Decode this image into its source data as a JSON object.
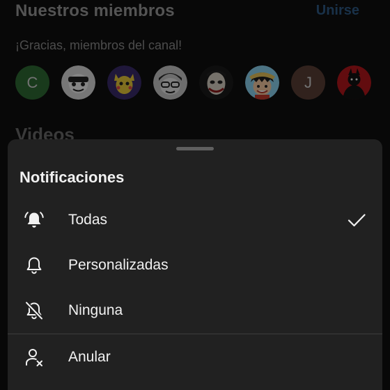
{
  "background": {
    "members_title": "Nuestros miembros",
    "join_label": "Unirse",
    "thanks_text": "¡Gracias, miembros del canal!",
    "members": [
      {
        "initial": "C",
        "type": "letter"
      },
      {
        "initial": "",
        "type": "avatar-1"
      },
      {
        "initial": "",
        "type": "avatar-2"
      },
      {
        "initial": "",
        "type": "avatar-3"
      },
      {
        "initial": "",
        "type": "avatar-4"
      },
      {
        "initial": "",
        "type": "avatar-5"
      },
      {
        "initial": "J",
        "type": "letter"
      },
      {
        "initial": "",
        "type": "avatar-6"
      }
    ],
    "videos_title": "Videos"
  },
  "sheet": {
    "title": "Notificaciones",
    "options": [
      {
        "label": "Todas",
        "icon": "bell-ringing-icon",
        "selected": true
      },
      {
        "label": "Personalizadas",
        "icon": "bell-icon",
        "selected": false
      },
      {
        "label": "Ninguna",
        "icon": "bell-off-icon",
        "selected": false
      }
    ],
    "unsubscribe_label": "Anular",
    "unsubscribe_icon": "person-remove-icon"
  },
  "colors": {
    "background": "#0f0f0f",
    "sheet": "#212121",
    "text": "#f1f1f1",
    "link": "#3ea6ff"
  }
}
